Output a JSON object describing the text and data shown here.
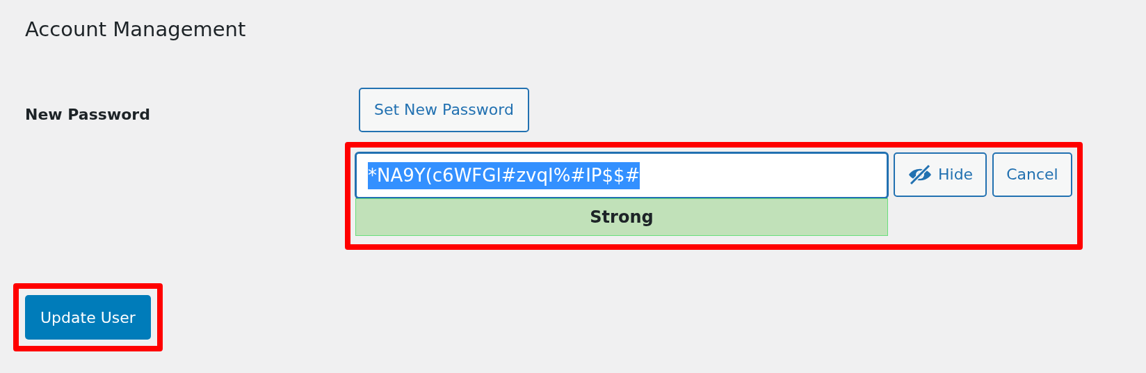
{
  "heading": "Account Management",
  "new_password": {
    "label": "New Password",
    "set_button": "Set New Password",
    "highlighted": true,
    "field": {
      "value": "*NA9Y(c6WFGl#zvqI%#IP$$#",
      "text_selected": true
    },
    "strength": {
      "label": "Strong",
      "kind": "strong"
    },
    "buttons": [
      {
        "kind": "hide",
        "label": "Hide"
      },
      {
        "kind": "cancel",
        "label": "Cancel"
      }
    ]
  },
  "submit": {
    "label": "Update User",
    "highlighted": true
  }
}
